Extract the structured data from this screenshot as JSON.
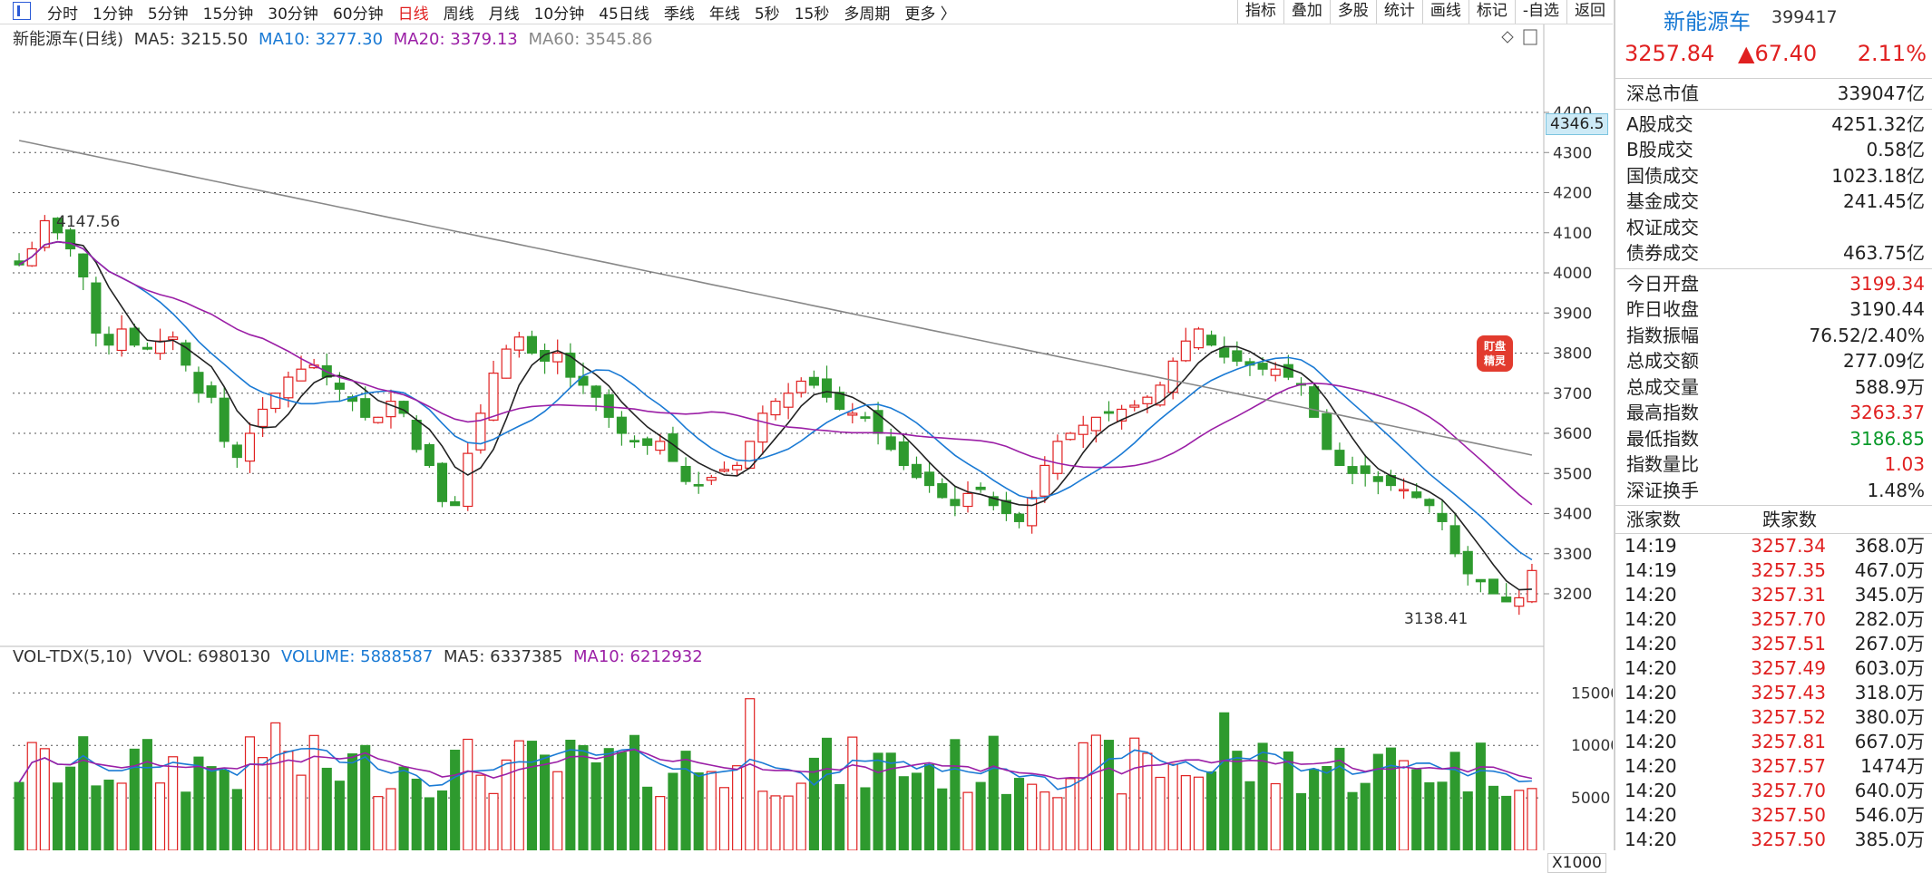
{
  "toolbar": {
    "periods": [
      "分时",
      "1分钟",
      "5分钟",
      "15分钟",
      "30分钟",
      "60分钟",
      "日线",
      "周线",
      "月线",
      "10分钟",
      "45日线",
      "季线",
      "年线",
      "5秒",
      "15秒",
      "多周期",
      "更多 〉"
    ],
    "active_period": "日线",
    "tools": [
      "指标",
      "叠加",
      "多股",
      "统计",
      "画线",
      "标记",
      "-自选",
      "返回"
    ]
  },
  "main_indicator": {
    "title": "新能源车(日线)",
    "ma5": "MA5: 3215.50",
    "ma10": "MA10: 3277.30",
    "ma20": "MA20: 3379.13",
    "ma60": "MA60: 3545.86"
  },
  "volume_indicator": {
    "title": "VOL-TDX(5,10)",
    "vvol": "VVOL: 6980130",
    "volume": "VOLUME: 5888587",
    "ma5": "MA5: 6337385",
    "ma10": "MA10: 6212932"
  },
  "price_axis": [
    "4400",
    "4300",
    "4200",
    "4100",
    "4000",
    "3900",
    "3800",
    "3700",
    "3600",
    "3500",
    "3400",
    "3300",
    "3200"
  ],
  "volume_axis": [
    "15000",
    "10000",
    "5000"
  ],
  "current_price_label": "4346.5",
  "high_label": "4147.56",
  "low_label": "3138.41",
  "volume_unit": "X1000",
  "badge": {
    "line1": "盯盘",
    "line2": "精灵"
  },
  "colors": {
    "up": "#e02020",
    "down": "#2e9a2e",
    "ma5": "#222222",
    "ma10": "#1a7ad4",
    "ma20": "#9b1fa6",
    "ma60": "#888888"
  },
  "panel": {
    "name": "新能源车",
    "code": "399417",
    "price": "3257.84",
    "change": "▲67.40",
    "change_pct": "2.11%",
    "market": [
      {
        "k": "深总市值",
        "v": "339047亿"
      }
    ],
    "turnover": [
      {
        "k": "A股成交",
        "v": "4251.32亿"
      },
      {
        "k": "B股成交",
        "v": "0.58亿"
      },
      {
        "k": "国债成交",
        "v": "1023.18亿"
      },
      {
        "k": "基金成交",
        "v": "241.45亿"
      },
      {
        "k": "权证成交",
        "v": ""
      },
      {
        "k": "债券成交",
        "v": "463.75亿"
      }
    ],
    "stats": [
      {
        "k": "今日开盘",
        "v": "3199.34",
        "c": "red"
      },
      {
        "k": "昨日收盘",
        "v": "3190.44",
        "c": ""
      },
      {
        "k": "指数振幅",
        "v": "76.52/2.40%",
        "c": ""
      },
      {
        "k": "总成交额",
        "v": "277.09亿",
        "c": ""
      },
      {
        "k": "总成交量",
        "v": "588.9万",
        "c": ""
      },
      {
        "k": "最高指数",
        "v": "3263.37",
        "c": "red"
      },
      {
        "k": "最低指数",
        "v": "3186.85",
        "c": "green"
      },
      {
        "k": "指数量比",
        "v": "1.03",
        "c": "red"
      },
      {
        "k": "深证换手",
        "v": "1.48%",
        "c": ""
      }
    ],
    "tick_header": [
      "涨家数",
      "跌家数"
    ],
    "ticks": [
      {
        "t": "14:19",
        "p": "3257.34",
        "q": "368.0万"
      },
      {
        "t": "14:19",
        "p": "3257.35",
        "q": "467.0万"
      },
      {
        "t": "14:20",
        "p": "3257.31",
        "q": "345.0万"
      },
      {
        "t": "14:20",
        "p": "3257.70",
        "q": "282.0万"
      },
      {
        "t": "14:20",
        "p": "3257.51",
        "q": "267.0万"
      },
      {
        "t": "14:20",
        "p": "3257.49",
        "q": "603.0万"
      },
      {
        "t": "14:20",
        "p": "3257.43",
        "q": "318.0万"
      },
      {
        "t": "14:20",
        "p": "3257.52",
        "q": "380.0万"
      },
      {
        "t": "14:20",
        "p": "3257.81",
        "q": "667.0万"
      },
      {
        "t": "14:20",
        "p": "3257.57",
        "q": "1474万"
      },
      {
        "t": "14:20",
        "p": "3257.70",
        "q": "640.0万"
      },
      {
        "t": "14:20",
        "p": "3257.50",
        "q": "546.0万"
      },
      {
        "t": "14:20",
        "p": "3257.50",
        "q": "385.0万"
      }
    ]
  },
  "chart_data": {
    "type": "candlestick",
    "close_path": [
      4020,
      4060,
      4130,
      4100,
      4060,
      3990,
      3850,
      3820,
      3860,
      3820,
      3810,
      3830,
      3840,
      3770,
      3700,
      3690,
      3580,
      3540,
      3600,
      3660,
      3700,
      3740,
      3760,
      3770,
      3740,
      3710,
      3680,
      3640,
      3640,
      3680,
      3650,
      3560,
      3520,
      3430,
      3420,
      3550,
      3650,
      3750,
      3810,
      3840,
      3800,
      3780,
      3800,
      3740,
      3720,
      3690,
      3640,
      3600,
      3580,
      3570,
      3580,
      3530,
      3480,
      3470,
      3490,
      3510,
      3520,
      3580,
      3650,
      3680,
      3700,
      3730,
      3720,
      3690,
      3660,
      3650,
      3640,
      3600,
      3560,
      3520,
      3490,
      3470,
      3440,
      3420,
      3450,
      3460,
      3420,
      3400,
      3380,
      3440,
      3520,
      3580,
      3600,
      3620,
      3640,
      3650,
      3660,
      3670,
      3690,
      3720,
      3780,
      3830,
      3860,
      3820,
      3790,
      3780,
      3770,
      3760,
      3760,
      3740,
      3720,
      3640,
      3560,
      3520,
      3500,
      3500,
      3480,
      3470,
      3460,
      3440,
      3420,
      3380,
      3300,
      3250,
      3230,
      3200,
      3180,
      3190,
      3258
    ],
    "ma_levels": {
      "ma5": 3215.5,
      "ma10": 3277.3,
      "ma20": 3379.13,
      "ma60": 3545.86
    },
    "volume_last": 5888587,
    "ylim_price": [
      3140,
      4420
    ],
    "ylim_volume": [
      0,
      16500
    ]
  }
}
